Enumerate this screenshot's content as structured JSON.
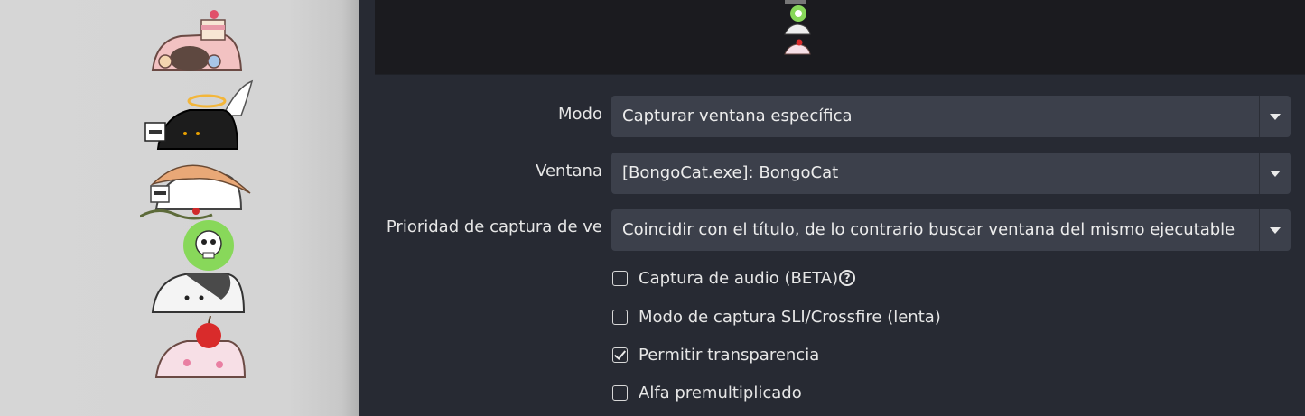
{
  "form": {
    "mode": {
      "label": "Modo",
      "value": "Capturar ventana específica"
    },
    "window": {
      "label": "Ventana",
      "value": "[BongoCat.exe]: BongoCat"
    },
    "priority": {
      "label": "Prioridad de captura de ve",
      "value": "Coincidir con el título, de lo contrario buscar ventana del mismo ejecutable"
    },
    "checkboxes": [
      {
        "label": "Captura de audio (BETA)",
        "checked": false,
        "help_icon": "question-circle-icon"
      },
      {
        "label": "Modo de captura SLI/Crossfire (lenta)",
        "checked": false
      },
      {
        "label": "Permitir transparencia",
        "checked": true
      },
      {
        "label": "Alfa premultiplicado",
        "checked": false
      }
    ]
  },
  "colors": {
    "panel_bg": "#272a33",
    "preview_bg": "#1b1b1f",
    "select_bg": "#3c404b",
    "canvas_bg": "#d6d6d6"
  },
  "canvas": {
    "stickers": [
      "cake-cat-icon",
      "angel-black-cat-icon",
      "hat-cat-icon",
      "green-skull-icon",
      "tuxedo-cat-icon",
      "apple-pink-cat-icon"
    ]
  }
}
